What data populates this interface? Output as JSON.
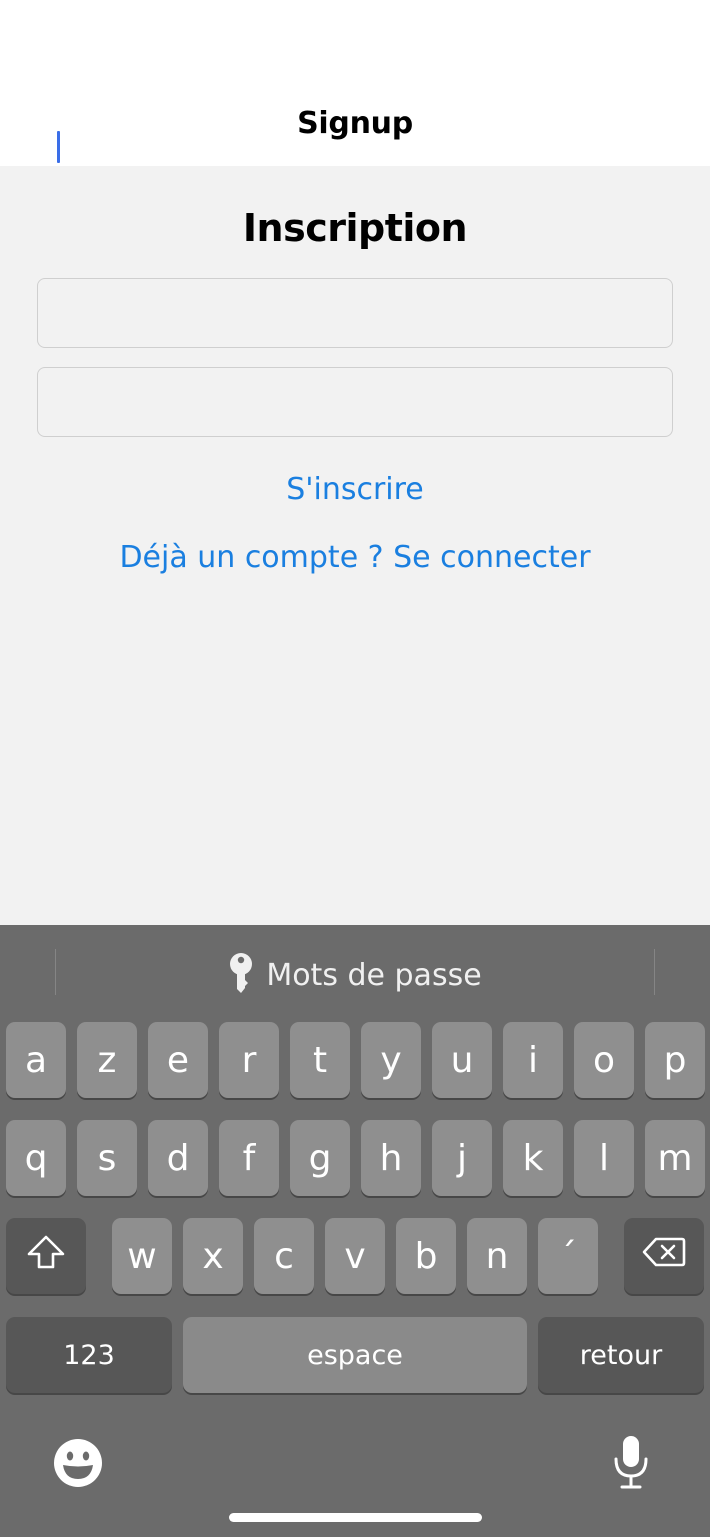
{
  "nav": {
    "title": "Signup"
  },
  "form": {
    "title": "Inscription",
    "username_value": "",
    "password_value": "",
    "signup_label": "S'inscrire",
    "login_link_label": "Déjà un compte ? Se connecter"
  },
  "keyboard": {
    "suggestion_label": "Mots de passe",
    "suggestion_icon": "key-icon",
    "row1": [
      "a",
      "z",
      "e",
      "r",
      "t",
      "y",
      "u",
      "i",
      "o",
      "p"
    ],
    "row2": [
      "q",
      "s",
      "d",
      "f",
      "g",
      "h",
      "j",
      "k",
      "l",
      "m"
    ],
    "row3": [
      "w",
      "x",
      "c",
      "v",
      "b",
      "n",
      "´"
    ],
    "numbers_label": "123",
    "space_label": "espace",
    "return_label": "retour",
    "shift_icon": "shift-icon",
    "delete_icon": "delete-icon",
    "emoji_icon": "emoji-icon",
    "mic_icon": "microphone-icon"
  },
  "colors": {
    "link": "#1a7fe0",
    "caret": "#3a6ee8",
    "keyboard_bg": "#6b6b6b",
    "key_bg": "#8f8f8f",
    "key_dark_bg": "#575757"
  }
}
